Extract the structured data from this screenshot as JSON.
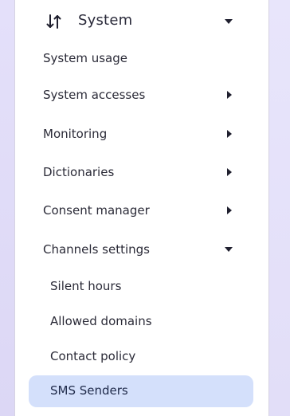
{
  "menu": {
    "section_title": "System",
    "section_icon": "sort-arrows-icon",
    "items": [
      {
        "label": "System usage"
      },
      {
        "label": "System accesses"
      },
      {
        "label": "Monitoring"
      },
      {
        "label": "Dictionaries"
      },
      {
        "label": "Consent manager"
      },
      {
        "label": "Channels settings"
      }
    ],
    "sub_items": [
      {
        "label": "Silent hours"
      },
      {
        "label": "Allowed domains"
      },
      {
        "label": "Contact policy"
      },
      {
        "label": "SMS Senders"
      }
    ]
  }
}
